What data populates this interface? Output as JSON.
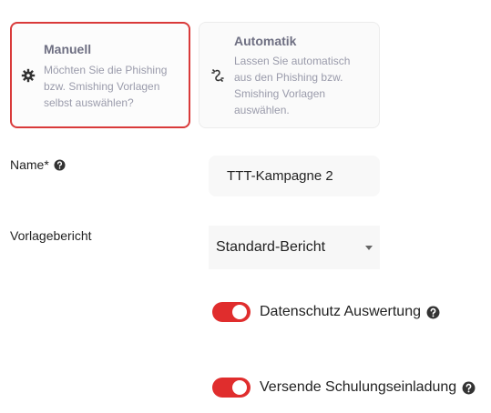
{
  "mode_cards": {
    "manual": {
      "title": "Manuell",
      "description": "Möchten Sie die Phishing bzw. Smishing Vorlagen selbst auswählen?",
      "icon": "gear-icon",
      "selected": true
    },
    "automatic": {
      "title": "Automatik",
      "description": "Lassen Sie automatisch aus den Phishing bzw. Smishing Vorlagen auswählen.",
      "icon": "unlink-icon",
      "selected": false
    }
  },
  "form": {
    "name": {
      "label": "Name*",
      "value": "TTT-Kampagne 2"
    },
    "template_report": {
      "label": "Vorlagebericht",
      "selected": "Standard-Bericht"
    },
    "toggles": [
      {
        "label": "Datenschutz Auswertung",
        "checked": true
      },
      {
        "label": "Versende Schulungseinladung",
        "checked": true
      }
    ]
  },
  "colors": {
    "accent": "#e02d2d",
    "selected_border": "#d93a3a"
  }
}
